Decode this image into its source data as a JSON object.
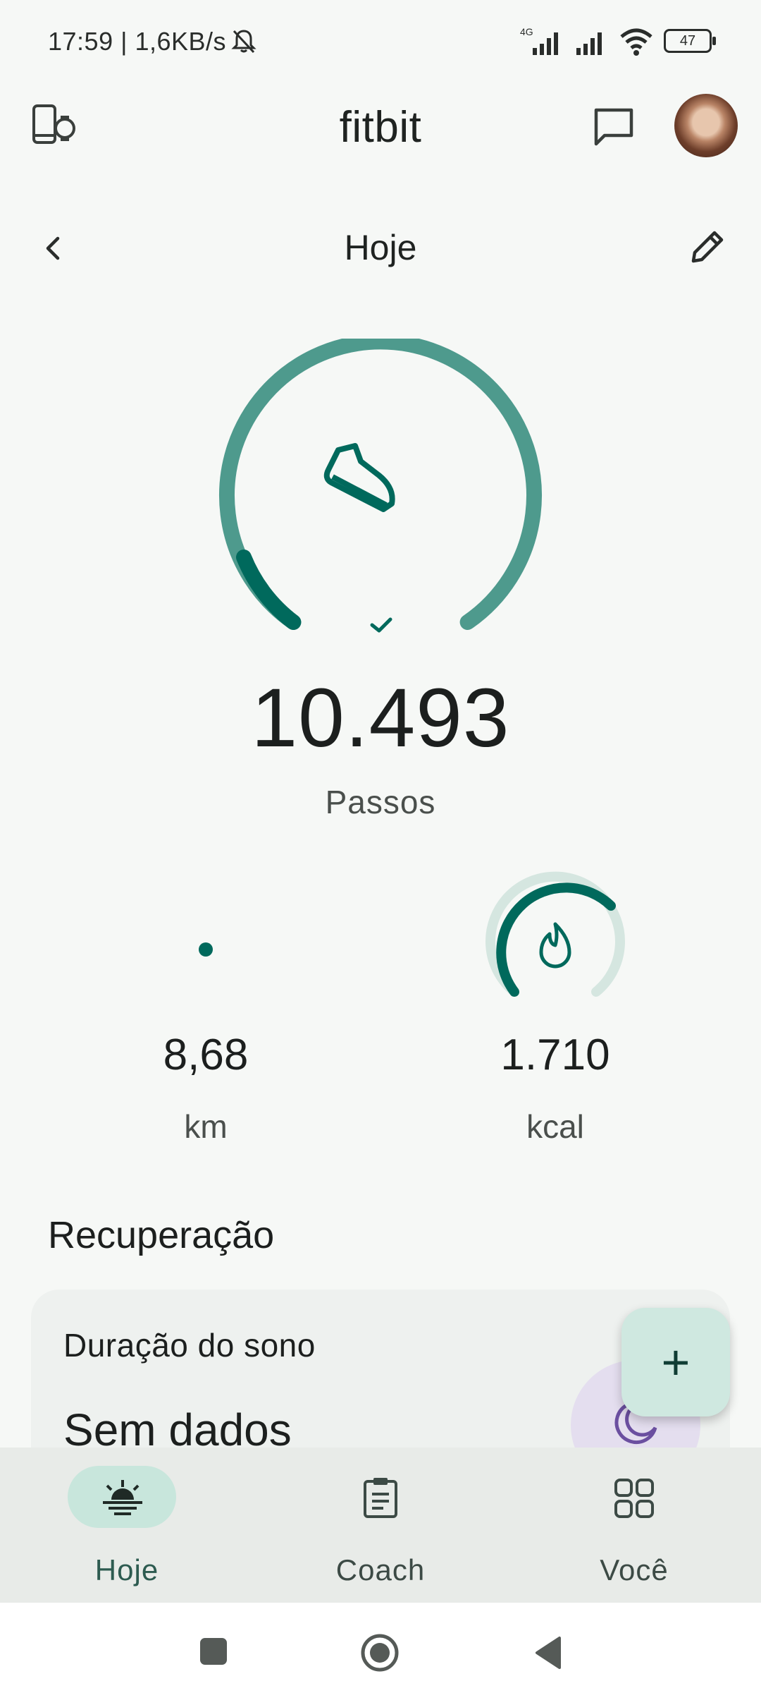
{
  "status_bar": {
    "time": "17:59 | 1,6KB/s",
    "network_label": "4G",
    "battery": "47",
    "icons": [
      "bell-off-icon",
      "signal-4g-icon",
      "signal-icon",
      "wifi-icon",
      "battery-icon"
    ]
  },
  "app_bar": {
    "title": "fitbit",
    "icons": [
      "devices-icon",
      "message-icon",
      "avatar"
    ]
  },
  "sub_header": {
    "title": "Hoje",
    "icons": [
      "back-chevron-icon",
      "edit-pencil-icon"
    ]
  },
  "steps": {
    "value": "10.493",
    "label": "Passos",
    "goal_reached": true,
    "progress_fraction": 1.0,
    "icon": "shoe-icon"
  },
  "stats": [
    {
      "value": "8,68",
      "unit": "km",
      "progress_fraction": 0.0
    },
    {
      "value": "1.710",
      "unit": "kcal",
      "progress_fraction": 0.65,
      "icon": "flame-icon"
    }
  ],
  "recovery": {
    "section_title": "Recuperação",
    "card_title": "Duração do sono",
    "card_value": "Sem dados",
    "icon": "moon-icon"
  },
  "fab": {
    "label": "+"
  },
  "bottom_nav": {
    "items": [
      {
        "label": "Hoje",
        "icon": "sunrise-icon",
        "active": true
      },
      {
        "label": "Coach",
        "icon": "clipboard-icon",
        "active": false
      },
      {
        "label": "Você",
        "icon": "grid-icon",
        "active": false
      }
    ]
  },
  "colors": {
    "accent": "#00695c",
    "ring_light": "#4e9a8d",
    "background": "#f6f8f6",
    "fab": "#cfe8e0",
    "nav_active_pill": "#c8e6dc"
  }
}
